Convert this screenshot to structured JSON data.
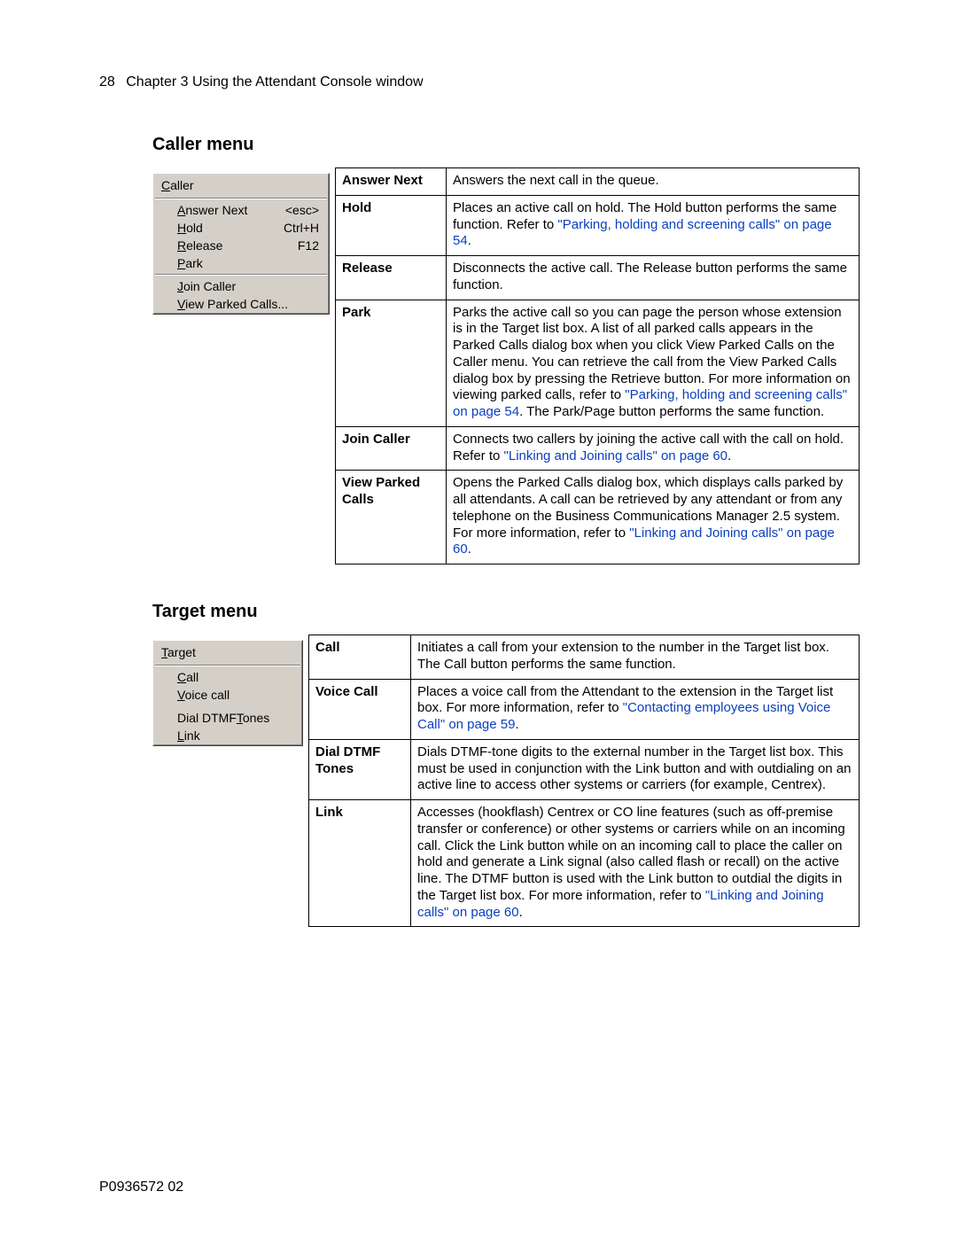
{
  "header": {
    "page_number": "28",
    "chapter": "Chapter 3  Using the Attendant Console window"
  },
  "sections": {
    "caller_heading": "Caller menu",
    "target_heading": "Target menu"
  },
  "caller_menu": {
    "title": "Caller",
    "items": [
      {
        "label_pre": "",
        "label_u": "A",
        "label_post": "nswer Next",
        "accel": "<esc>"
      },
      {
        "label_pre": "",
        "label_u": "H",
        "label_post": "old",
        "accel": "Ctrl+H"
      },
      {
        "label_pre": "",
        "label_u": "R",
        "label_post": "elease",
        "accel": "F12"
      },
      {
        "label_pre": "",
        "label_u": "P",
        "label_post": "ark",
        "accel": ""
      },
      {
        "sep": true
      },
      {
        "label_pre": "",
        "label_u": "J",
        "label_post": "oin Caller",
        "accel": ""
      },
      {
        "label_pre": "",
        "label_u": "V",
        "label_post": "iew Parked Calls...",
        "accel": ""
      }
    ]
  },
  "caller_rows": [
    {
      "term": "Answer Next",
      "desc": "Answers the next call in the queue."
    },
    {
      "term": "Hold",
      "desc_before": "Places an active call on hold. The Hold button performs the same function. Refer to ",
      "link": "\"Parking, holding and screening calls\" on page 54",
      "desc_after": "."
    },
    {
      "term": "Release",
      "desc": "Disconnects the active call. The Release button performs the same function."
    },
    {
      "term": "Park",
      "desc_before": "Parks the active call so you can page the person whose extension is in the Target list box. A list of all parked calls appears in the Parked Calls dialog box when you click View Parked Calls on the Caller menu. You can retrieve the call from the View Parked Calls dialog box by pressing the Retrieve button. For more information on viewing parked calls, refer to ",
      "link": "\"Parking, holding and screening calls\" on page 54",
      "desc_after": ". The Park/Page button performs the same function."
    },
    {
      "term": "Join Caller",
      "desc_before": "Connects two callers by joining the active call with the call on hold. Refer to ",
      "link": "\"Linking and Joining calls\" on page 60",
      "desc_after": "."
    },
    {
      "term": "View Parked Calls",
      "desc_before": "Opens the Parked Calls dialog box, which displays calls parked by all attendants. A call can be retrieved by any attendant or from any telephone on the Business Communications Manager 2.5 system. For more information, refer to ",
      "link": "\"Linking and Joining calls\" on page 60",
      "desc_after": "."
    }
  ],
  "target_menu": {
    "title": "Target",
    "items": [
      {
        "label_pre": "",
        "label_u": "C",
        "label_post": "all"
      },
      {
        "label_pre": "",
        "label_u": "V",
        "label_post": "oice call"
      },
      {
        "sep_blank": true
      },
      {
        "label_pre": "Dial DTMF",
        "label_u": "T",
        "label_post": "ones"
      },
      {
        "label_pre": "",
        "label_u": "L",
        "label_post": "ink"
      }
    ]
  },
  "target_rows": [
    {
      "term": "Call",
      "desc": "Initiates a call from your extension to the number in the Target list box. The Call button performs the same function."
    },
    {
      "term": "Voice Call",
      "desc_before": "Places a voice call from the Attendant to the extension in the Target list box. For more information, refer to ",
      "link": "\"Contacting employees using Voice Call\" on page 59",
      "desc_after": "."
    },
    {
      "term": "Dial DTMF Tones",
      "desc": "Dials DTMF-tone digits to the external number in the Target list box. This must be used in conjunction with the Link button and with outdialing on an active line to access other systems or carriers (for example, Centrex)."
    },
    {
      "term": "Link",
      "desc_before": "Accesses (hookflash) Centrex or CO line features (such as off-premise transfer or conference) or other systems or carriers while on an incoming call. Click the Link button while on an incoming call to place the caller on hold and generate a Link signal (also called flash or recall) on the active line. The DTMF button is used with the Link button to outdial the digits in the Target list box. For more information, refer to ",
      "link": "\"Linking and Joining calls\" on page 60",
      "desc_after": "."
    }
  ],
  "footer": "P0936572 02"
}
